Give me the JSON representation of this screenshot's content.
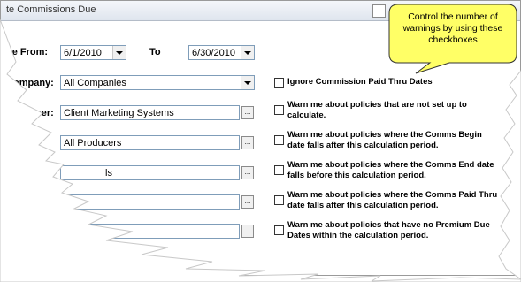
{
  "window": {
    "title": "te Commissions Due"
  },
  "form": {
    "due_from_label": "ue From:",
    "due_from_value": "6/1/2010",
    "to_label": "To",
    "to_value": "6/30/2010",
    "company_label": "ompany:",
    "company_value": "All Companies",
    "agency_label": "mer:",
    "agency_value": "Client Marketing Systems",
    "producer_value": "All Producers",
    "field4_value": "ls",
    "picker_button": "..."
  },
  "checkboxes": [
    {
      "text": "Ignore Commission Paid Thru Dates",
      "checked": false
    },
    {
      "text": "Warn me about policies that are not set up to calculate.",
      "checked": false
    },
    {
      "text": "Warn me about policies where the Comms Begin date falls after this calculation period.",
      "checked": false
    },
    {
      "text": "Warn me about policies where the Comms End date falls before this calculation period.",
      "checked": false
    },
    {
      "text": "Warn me about policies where the Comms Paid Thru date falls after this calculation period.",
      "checked": false
    },
    {
      "text": "Warn me about policies that have no Premium Due Dates within the calculation period.",
      "checked": false
    }
  ],
  "callout": {
    "text": "Control the number of warnings by using these checkboxes",
    "color": "#ffff66"
  }
}
